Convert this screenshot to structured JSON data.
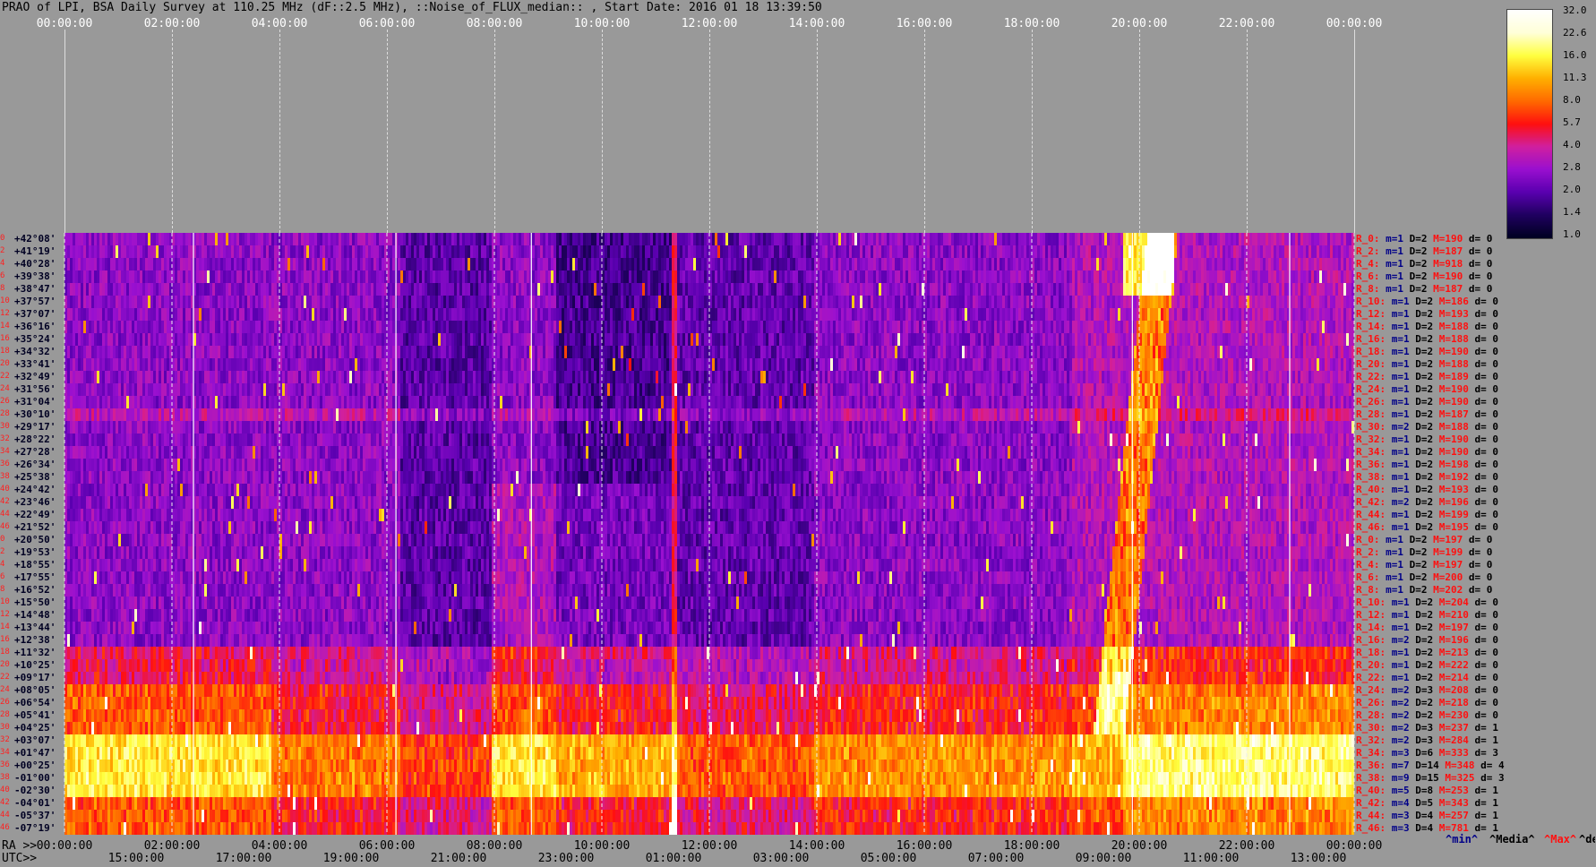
{
  "title": "PRAO of LPI, BSA Daily Survey at 110.25 MHz (dF::2.5 MHz), ::Noise_of_FLUX_median:: , Start Date: 2016 01 18 13:39:50",
  "top_axis_ticks": [
    "00:00:00",
    "02:00:00",
    "04:00:00",
    "06:00:00",
    "08:00:00",
    "10:00:00",
    "12:00:00",
    "14:00:00",
    "16:00:00",
    "18:00:00",
    "20:00:00",
    "22:00:00",
    "00:00:00"
  ],
  "bottom_axis": {
    "ra_prefix": "RA >>",
    "utc_prefix": "UTC>>",
    "ra_ticks": [
      "00:00:00",
      "02:00:00",
      "04:00:00",
      "06:00:00",
      "08:00:00",
      "10:00:00",
      "12:00:00",
      "14:00:00",
      "16:00:00",
      "18:00:00",
      "20:00:00",
      "22:00:00",
      "00:00:00"
    ],
    "utc_ticks": [
      "15:00:00",
      "17:00:00",
      "19:00:00",
      "21:00:00",
      "23:00:00",
      "01:00:00",
      "03:00:00",
      "05:00:00",
      "07:00:00",
      "09:00:00",
      "11:00:00",
      "13:00:00"
    ]
  },
  "legend": {
    "min": "^min^",
    "media": "^Media^",
    "max": "^Max^",
    "devia": "^devia^",
    "colors": {
      "min": "#000088",
      "media": "#000000",
      "max": "#ff1010",
      "devia": "#000000"
    }
  },
  "colorbar_labels": [
    "32.0",
    "22.6",
    "16.0",
    "11.3",
    "8.0",
    "5.7",
    "4.0",
    "2.8",
    "2.0",
    "1.4",
    "1.0"
  ],
  "declinations": [
    "+42°08'",
    "+41°19'",
    "+40°28'",
    "+39°38'",
    "+38°47'",
    "+37°57'",
    "+37°07'",
    "+36°16'",
    "+35°24'",
    "+34°32'",
    "+33°41'",
    "+32°49'",
    "+31°56'",
    "+31°04'",
    "+30°10'",
    "+29°17'",
    "+28°22'",
    "+27°28'",
    "+26°34'",
    "+25°38'",
    "+24°42'",
    "+23°46'",
    "+22°49'",
    "+21°52'",
    "+20°50'",
    "+19°53'",
    "+18°55'",
    "+17°55'",
    "+16°52'",
    "+15°50'",
    "+14°48'",
    "+13°44'",
    "+12°38'",
    "+11°32'",
    "+10°25'",
    "+09°17'",
    "+08°05'",
    "+06°54'",
    "+05°41'",
    "+04°25'",
    "+03°07'",
    "+01°47'",
    "+00°25'",
    "-01°00'",
    "-02°30'",
    "-04°01'",
    "-05°37'",
    "-07°19'"
  ],
  "row_indices": [
    "0",
    "2",
    "4",
    "6",
    "8",
    "10",
    "12",
    "14",
    "16",
    "18",
    "20",
    "22",
    "24",
    "26",
    "28",
    "30",
    "32",
    "34",
    "36",
    "38",
    "40",
    "42",
    "44",
    "46",
    "0",
    "2",
    "4",
    "6",
    "8",
    "10",
    "12",
    "14",
    "16",
    "18",
    "20",
    "22",
    "24",
    "26",
    "28",
    "30",
    "32",
    "34",
    "36",
    "38",
    "40",
    "42",
    "44",
    "46"
  ],
  "right_rows": [
    {
      "r": "R_0:",
      "m": "m=1",
      "d": "D=2",
      "M": "M=190",
      "dv": "d= 0"
    },
    {
      "r": "R_2:",
      "m": "m=1",
      "d": "D=2",
      "M": "M=187",
      "dv": "d= 0"
    },
    {
      "r": "R_4:",
      "m": "m=1",
      "d": "D=2",
      "M": "M=918",
      "dv": "d= 0"
    },
    {
      "r": "R_6:",
      "m": "m=1",
      "d": "D=2",
      "M": "M=190",
      "dv": "d= 0"
    },
    {
      "r": "R_8:",
      "m": "m=1",
      "d": "D=2",
      "M": "M=187",
      "dv": "d= 0"
    },
    {
      "r": "R_10:",
      "m": "m=1",
      "d": "D=2",
      "M": "M=186",
      "dv": "d= 0"
    },
    {
      "r": "R_12:",
      "m": "m=1",
      "d": "D=2",
      "M": "M=193",
      "dv": "d= 0"
    },
    {
      "r": "R_14:",
      "m": "m=1",
      "d": "D=2",
      "M": "M=188",
      "dv": "d= 0"
    },
    {
      "r": "R_16:",
      "m": "m=1",
      "d": "D=2",
      "M": "M=188",
      "dv": "d= 0"
    },
    {
      "r": "R_18:",
      "m": "m=1",
      "d": "D=2",
      "M": "M=190",
      "dv": "d= 0"
    },
    {
      "r": "R_20:",
      "m": "m=1",
      "d": "D=2",
      "M": "M=188",
      "dv": "d= 0"
    },
    {
      "r": "R_22:",
      "m": "m=1",
      "d": "D=2",
      "M": "M=189",
      "dv": "d= 0"
    },
    {
      "r": "R_24:",
      "m": "m=1",
      "d": "D=2",
      "M": "M=190",
      "dv": "d= 0"
    },
    {
      "r": "R_26:",
      "m": "m=1",
      "d": "D=2",
      "M": "M=190",
      "dv": "d= 0"
    },
    {
      "r": "R_28:",
      "m": "m=1",
      "d": "D=2",
      "M": "M=187",
      "dv": "d= 0"
    },
    {
      "r": "R_30:",
      "m": "m=2",
      "d": "D=2",
      "M": "M=188",
      "dv": "d= 0"
    },
    {
      "r": "R_32:",
      "m": "m=1",
      "d": "D=2",
      "M": "M=190",
      "dv": "d= 0"
    },
    {
      "r": "R_34:",
      "m": "m=1",
      "d": "D=2",
      "M": "M=190",
      "dv": "d= 0"
    },
    {
      "r": "R_36:",
      "m": "m=1",
      "d": "D=2",
      "M": "M=198",
      "dv": "d= 0"
    },
    {
      "r": "R_38:",
      "m": "m=1",
      "d": "D=2",
      "M": "M=192",
      "dv": "d= 0"
    },
    {
      "r": "R_40:",
      "m": "m=1",
      "d": "D=2",
      "M": "M=193",
      "dv": "d= 0"
    },
    {
      "r": "R_42:",
      "m": "m=2",
      "d": "D=2",
      "M": "M=196",
      "dv": "d= 0"
    },
    {
      "r": "R_44:",
      "m": "m=1",
      "d": "D=2",
      "M": "M=199",
      "dv": "d= 0"
    },
    {
      "r": "R_46:",
      "m": "m=1",
      "d": "D=2",
      "M": "M=195",
      "dv": "d= 0"
    },
    {
      "r": "R_0:",
      "m": "m=1",
      "d": "D=2",
      "M": "M=197",
      "dv": "d= 0"
    },
    {
      "r": "R_2:",
      "m": "m=1",
      "d": "D=2",
      "M": "M=199",
      "dv": "d= 0"
    },
    {
      "r": "R_4:",
      "m": "m=1",
      "d": "D=2",
      "M": "M=197",
      "dv": "d= 0"
    },
    {
      "r": "R_6:",
      "m": "m=1",
      "d": "D=2",
      "M": "M=200",
      "dv": "d= 0"
    },
    {
      "r": "R_8:",
      "m": "m=1",
      "d": "D=2",
      "M": "M=202",
      "dv": "d= 0"
    },
    {
      "r": "R_10:",
      "m": "m=1",
      "d": "D=2",
      "M": "M=204",
      "dv": "d= 0"
    },
    {
      "r": "R_12:",
      "m": "m=1",
      "d": "D=2",
      "M": "M=210",
      "dv": "d= 0"
    },
    {
      "r": "R_14:",
      "m": "m=1",
      "d": "D=2",
      "M": "M=197",
      "dv": "d= 0"
    },
    {
      "r": "R_16:",
      "m": "m=2",
      "d": "D=2",
      "M": "M=196",
      "dv": "d= 0"
    },
    {
      "r": "R_18:",
      "m": "m=1",
      "d": "D=2",
      "M": "M=213",
      "dv": "d= 0"
    },
    {
      "r": "R_20:",
      "m": "m=1",
      "d": "D=2",
      "M": "M=222",
      "dv": "d= 0"
    },
    {
      "r": "R_22:",
      "m": "m=1",
      "d": "D=2",
      "M": "M=214",
      "dv": "d= 0"
    },
    {
      "r": "R_24:",
      "m": "m=2",
      "d": "D=3",
      "M": "M=208",
      "dv": "d= 0"
    },
    {
      "r": "R_26:",
      "m": "m=2",
      "d": "D=2",
      "M": "M=218",
      "dv": "d= 0"
    },
    {
      "r": "R_28:",
      "m": "m=2",
      "d": "D=2",
      "M": "M=230",
      "dv": "d= 0"
    },
    {
      "r": "R_30:",
      "m": "m=2",
      "d": "D=3",
      "M": "M=237",
      "dv": "d= 1"
    },
    {
      "r": "R_32:",
      "m": "m=2",
      "d": "D=3",
      "M": "M=284",
      "dv": "d= 1"
    },
    {
      "r": "R_34:",
      "m": "m=3",
      "d": "D=6",
      "M": "M=333",
      "dv": "d= 3"
    },
    {
      "r": "R_36:",
      "m": "m=7",
      "d": "D=14",
      "M": "M=348",
      "dv": "d= 4"
    },
    {
      "r": "R_38:",
      "m": "m=9",
      "d": "D=15",
      "M": "M=325",
      "dv": "d= 3"
    },
    {
      "r": "R_40:",
      "m": "m=5",
      "d": "D=8",
      "M": "M=253",
      "dv": "d= 1"
    },
    {
      "r": "R_42:",
      "m": "m=4",
      "d": "D=5",
      "M": "M=343",
      "dv": "d= 1"
    },
    {
      "r": "R_44:",
      "m": "m=3",
      "d": "D=4",
      "M": "M=257",
      "dv": "d= 1"
    },
    {
      "r": "R_46:",
      "m": "m=3",
      "d": "D=4",
      "M": "M=781",
      "dv": "d= 1"
    }
  ],
  "chart_data": {
    "type": "heatmap",
    "title": "PRAO of LPI, BSA Daily Survey at 110.25 MHz (dF::2.5 MHz), ::Noise_of_FLUX_median:: , Start Date: 2016 01 18 13:39:50",
    "x_axis_ra": [
      "00:00:00",
      "02:00:00",
      "04:00:00",
      "06:00:00",
      "08:00:00",
      "10:00:00",
      "12:00:00",
      "14:00:00",
      "16:00:00",
      "18:00:00",
      "20:00:00",
      "22:00:00",
      "00:00:00"
    ],
    "x_axis_utc": [
      "15:00:00",
      "17:00:00",
      "19:00:00",
      "21:00:00",
      "23:00:00",
      "01:00:00",
      "03:00:00",
      "05:00:00",
      "07:00:00",
      "09:00:00",
      "11:00:00",
      "13:00:00"
    ],
    "colorbar_range": [
      1.0,
      32.0
    ],
    "colorbar_scale": "log",
    "colormap": [
      "#000022",
      "#200060",
      "#5a00b0",
      "#9a10d0",
      "#d020a0",
      "#ff1010",
      "#ff6a00",
      "#ffb000",
      "#ffff40",
      "#ffffd8",
      "#ffffff"
    ],
    "background_color": "#999999"
  }
}
